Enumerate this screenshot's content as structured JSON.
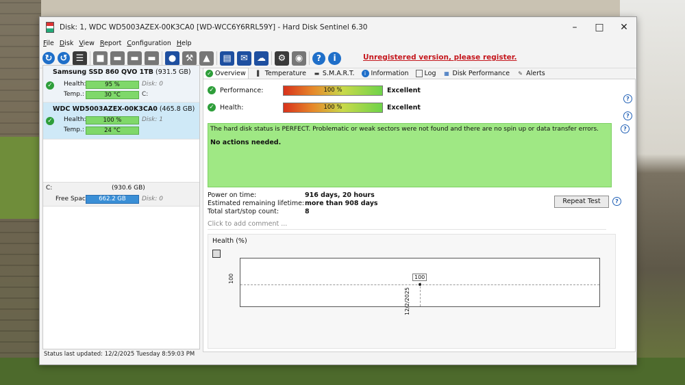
{
  "window": {
    "title": "Disk: 1, WDC WD5003AZEX-00K3CA0 [WD-WCC6Y6RRL59Y]  -  Hard Disk Sentinel 6.30",
    "minimize": "–",
    "maximize": "□",
    "close": "✕"
  },
  "menu": [
    "File",
    "Disk",
    "View",
    "Report",
    "Configuration",
    "Help"
  ],
  "toolbar": {
    "unregistered": "Unregistered version, please register."
  },
  "disks": [
    {
      "name": "Samsung SSD 860 QVO 1TB",
      "capacity": "(931.5 GB)",
      "health_label": "Health:",
      "health": "95 %",
      "health_extra": "Disk: 0",
      "temp_label": "Temp.:",
      "temp": "30 °C",
      "temp_extra": "C:"
    },
    {
      "name": "WDC WD5003AZEX-00K3CA0",
      "capacity": "(465.8 GB)",
      "health_label": "Health:",
      "health": "100 %",
      "health_extra": "Disk: 1",
      "temp_label": "Temp.:",
      "temp": "24 °C"
    }
  ],
  "volume": {
    "letter": "C:",
    "size": "(930.6 GB)",
    "free_label": "Free Space",
    "free": "662.2 GB",
    "disk": "Disk: 0"
  },
  "statusbar": "Status last updated: 12/2/2025 Tuesday 8:59:03 PM",
  "tabs": [
    "Overview",
    "Temperature",
    "S.M.A.R.T.",
    "Information",
    "Log",
    "Disk Performance",
    "Alerts"
  ],
  "overview": {
    "performance_label": "Performance:",
    "performance_value": "100 %",
    "performance_rating": "Excellent",
    "health_label": "Health:",
    "health_value": "100 %",
    "health_rating": "Excellent",
    "status_text": "The hard disk status is PERFECT. Problematic or weak sectors were not found and there are no spin up or data transfer errors.",
    "status_action": "No actions needed.",
    "power_on_label": "Power on time:",
    "power_on_value": "916 days, 20 hours",
    "lifetime_label": "Estimated remaining lifetime:",
    "lifetime_value": "more than 908 days",
    "startstop_label": "Total start/stop count:",
    "startstop_value": "8",
    "repeat_test": "Repeat Test",
    "comment_placeholder": "Click to add comment ..."
  },
  "chart_data": {
    "type": "line",
    "title": "Health (%)",
    "x": [
      "12/2/2025"
    ],
    "series": [
      {
        "values": [
          100
        ]
      }
    ],
    "data_labels": [
      "100"
    ],
    "ytick_labels": [
      "100"
    ],
    "xtick_labels": [
      "12/2/2025"
    ]
  }
}
